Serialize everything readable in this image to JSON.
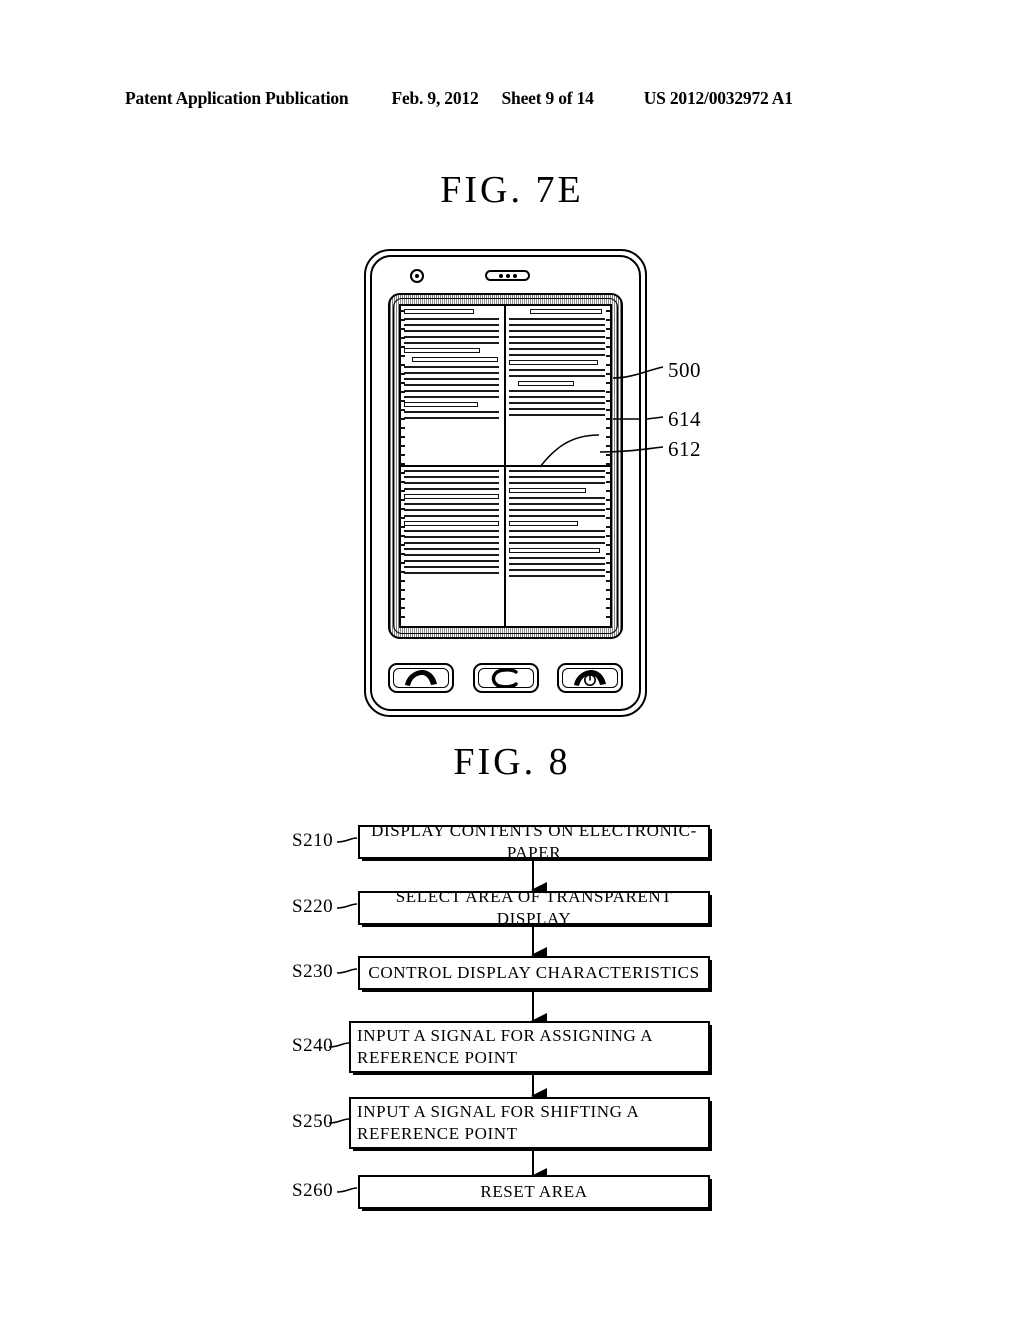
{
  "header": {
    "publication": "Patent Application Publication",
    "date": "Feb. 9, 2012",
    "sheet": "Sheet 9 of 14",
    "number": "US 2012/0032972 A1"
  },
  "figures": {
    "fig7e": {
      "title": "FIG.  7E",
      "device": {
        "camera_icon": "camera-lens-icon",
        "speaker_icon": "earpiece-speaker-icon",
        "keys": [
          {
            "name": "call-key",
            "icon": "handset-call-icon"
          },
          {
            "name": "menu-key",
            "icon": "c-shape-menu-icon"
          },
          {
            "name": "end-call-power-key",
            "icon": "handset-power-icon"
          }
        ]
      },
      "reference_numerals": [
        {
          "id": "500",
          "label": "500",
          "target": "electronic-paper-display"
        },
        {
          "id": "614",
          "label": "614",
          "target": "transparent-display-area"
        },
        {
          "id": "612",
          "label": "612",
          "target": "reference-point-region"
        }
      ]
    },
    "fig8": {
      "title": "FIG.  8",
      "steps": [
        {
          "tag": "S210",
          "text": "DISPLAY CONTENTS ON ELECTRONIC-PAPER",
          "align": "center"
        },
        {
          "tag": "S220",
          "text": "SELECT AREA OF TRANSPARENT DISPLAY",
          "align": "center"
        },
        {
          "tag": "S230",
          "text": "CONTROL DISPLAY CHARACTERISTICS",
          "align": "center"
        },
        {
          "tag": "S240",
          "text": "INPUT A SIGNAL FOR ASSIGNING A REFERENCE POINT",
          "align": "left"
        },
        {
          "tag": "S250",
          "text": "INPUT A SIGNAL FOR SHIFTING A REFERENCE POINT",
          "align": "left"
        },
        {
          "tag": "S260",
          "text": "RESET AREA",
          "align": "center"
        }
      ]
    }
  },
  "colors": {
    "ink": "#000000",
    "paper": "#ffffff",
    "bezel": "#bdbdbd"
  }
}
